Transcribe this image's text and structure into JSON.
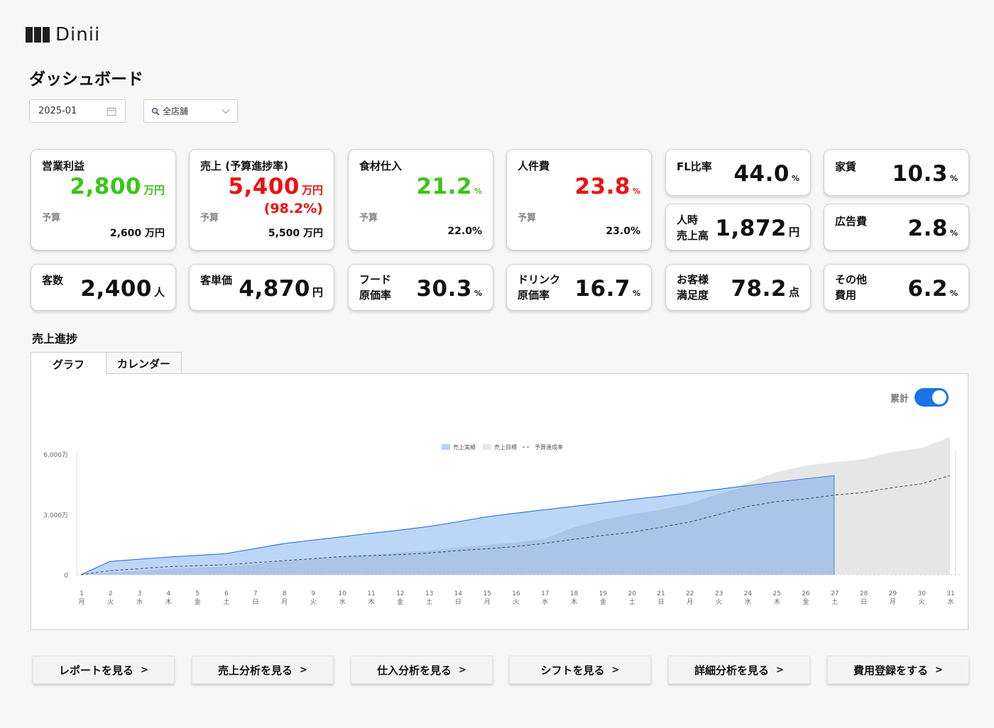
{
  "app": {
    "brand": "Dinii"
  },
  "page": {
    "title": "ダッシュボード"
  },
  "filters": {
    "month": "2025-01",
    "store": "全店舗"
  },
  "kpi_budget_cards": [
    {
      "label": "営業利益",
      "value": "2,800",
      "unit": "万円",
      "value_color": "green",
      "sub": "",
      "budget_label": "予算",
      "budget_value": "2,600 万円"
    },
    {
      "label": "売上 (予算進捗率)",
      "value": "5,400",
      "unit": "万円",
      "value_color": "red",
      "sub": "(98.2%)",
      "budget_label": "予算",
      "budget_value": "5,500 万円"
    },
    {
      "label": "食材仕入",
      "value": "21.2",
      "unit": "%",
      "value_color": "green",
      "sub": "",
      "budget_label": "予算",
      "budget_value": "22.0%"
    },
    {
      "label": "人件費",
      "value": "23.8",
      "unit": "%",
      "value_color": "red",
      "sub": "",
      "budget_label": "予算",
      "budget_value": "23.0%"
    }
  ],
  "kpi_small_cards": [
    {
      "label": "FL比率",
      "value": "44.0",
      "unit": "%"
    },
    {
      "label": "家賃",
      "value": "10.3",
      "unit": "%"
    },
    {
      "label": "人時\n売上高",
      "value": "1,872",
      "unit": "円"
    },
    {
      "label": "広告費",
      "value": "2.8",
      "unit": "%"
    }
  ],
  "kpi_row2_cards": [
    {
      "label": "客数",
      "value": "2,400",
      "unit": "人"
    },
    {
      "label": "客単価",
      "value": "4,870",
      "unit": "円"
    },
    {
      "label": "フード\n原価率",
      "value": "30.3",
      "unit": "%"
    },
    {
      "label": "ドリンク\n原価率",
      "value": "16.7",
      "unit": "%"
    },
    {
      "label": "お客様\n満足度",
      "value": "78.2",
      "unit": "点"
    },
    {
      "label": "その他\n費用",
      "value": "6.2",
      "unit": "%"
    }
  ],
  "sales_progress": {
    "title": "売上進捗",
    "tabs": [
      "グラフ",
      "カレンダー"
    ],
    "active_tab": "グラフ",
    "cumulative_toggle": {
      "label": "累計",
      "on": true
    }
  },
  "chart_data": {
    "type": "area",
    "legend": [
      "売上実績",
      "売上目標",
      "予算達成率"
    ],
    "y_tick_labels": [
      "0",
      "3,000万",
      "6,000万"
    ],
    "ylim": [
      0,
      6000
    ],
    "days": [
      "1",
      "2",
      "3",
      "4",
      "5",
      "6",
      "7",
      "8",
      "9",
      "10",
      "11",
      "12",
      "13",
      "14",
      "15",
      "16",
      "17",
      "18",
      "19",
      "20",
      "21",
      "22",
      "23",
      "24",
      "25",
      "26",
      "27",
      "28",
      "29",
      "30",
      "31"
    ],
    "weekdays": [
      "月",
      "火",
      "水",
      "木",
      "金",
      "土",
      "日",
      "月",
      "火",
      "水",
      "木",
      "金",
      "土",
      "日",
      "月",
      "火",
      "水",
      "木",
      "金",
      "土",
      "日",
      "月",
      "火",
      "水",
      "木",
      "金",
      "土",
      "日",
      "月",
      "火",
      "水"
    ],
    "series": [
      {
        "name": "売上実績",
        "values": [
          0,
          660,
          770,
          880,
          960,
          1050,
          1300,
          1550,
          1720,
          1890,
          2060,
          2220,
          2400,
          2630,
          2880,
          3060,
          3230,
          3400,
          3570,
          3740,
          3900,
          4080,
          4250,
          4430,
          4600,
          4770,
          4930
        ]
      },
      {
        "name": "売上目標",
        "values": [
          0,
          100,
          200,
          300,
          350,
          420,
          520,
          680,
          800,
          900,
          1000,
          1100,
          1200,
          1350,
          1480,
          1600,
          1780,
          2350,
          2720,
          3000,
          3230,
          3540,
          4010,
          4560,
          5100,
          5430,
          5600,
          5750,
          6100,
          6300,
          6850
        ]
      },
      {
        "name": "予算達成率",
        "values": [
          0,
          200,
          300,
          400,
          450,
          500,
          600,
          700,
          800,
          900,
          950,
          1000,
          1080,
          1200,
          1290,
          1400,
          1560,
          1760,
          1950,
          2110,
          2360,
          2620,
          2990,
          3390,
          3640,
          3770,
          3960,
          4090,
          4330,
          4520,
          4930
        ]
      }
    ]
  },
  "actions": [
    {
      "label": "レポートを見る",
      "chev": ">"
    },
    {
      "label": "売上分析を見る",
      "chev": ">"
    },
    {
      "label": "仕入分析を見る",
      "chev": ">"
    },
    {
      "label": "シフトを見る",
      "chev": ">"
    },
    {
      "label": "詳細分析を見る",
      "chev": ">"
    },
    {
      "label": "費用登録をする",
      "chev": ">"
    }
  ],
  "colors": {
    "accent": "#1a73e8",
    "positive": "#3cc41a",
    "negative": "#ee1111",
    "actual_fill": "#b5d2f7",
    "actual_stroke": "#1a67d6",
    "target_fill": "#e6e6e6"
  }
}
